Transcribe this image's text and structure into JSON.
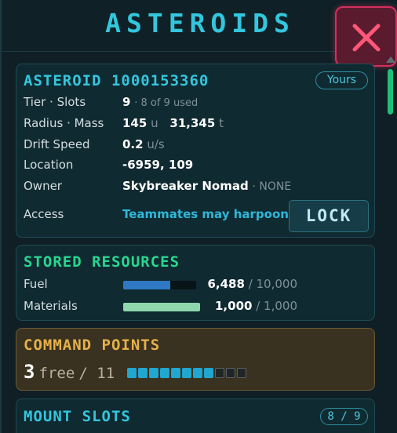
{
  "header": {
    "title": "ASTEROIDS"
  },
  "asteroid": {
    "name": "ASTEROID 1000153360",
    "ownership_badge": "Yours",
    "tier_slots": {
      "label": "Tier · Slots",
      "value": "9",
      "detail": "· 8 of 9 used"
    },
    "radius_mass": {
      "label": "Radius · Mass",
      "radius": "145",
      "radius_unit": "u",
      "mass": "31,345",
      "mass_unit": "t"
    },
    "drift_speed": {
      "label": "Drift Speed",
      "value": "0.2",
      "unit": "u/s"
    },
    "location": {
      "label": "Location",
      "value": "-6959, 109"
    },
    "owner": {
      "label": "Owner",
      "value": "Skybreaker Nomad",
      "detail": "· NONE"
    },
    "access": {
      "label": "Access",
      "value": "Teammates may harpoon",
      "button": "LOCK"
    }
  },
  "resources": {
    "title": "STORED RESOURCES",
    "items": [
      {
        "label": "Fuel",
        "amount": "6,488",
        "capacity": "/ 10,000",
        "fill_fraction": 0.6488,
        "color": "#2f78c4"
      },
      {
        "label": "Materials",
        "amount": "1,000",
        "capacity": "/ 1,000",
        "fill_fraction": 1.0,
        "color": "#8fd7ad"
      }
    ]
  },
  "command_points": {
    "title": "COMMAND POINTS",
    "free": "3",
    "free_label": "free",
    "total": "/ 11",
    "segments_total": 11,
    "segments_filled": 8
  },
  "mount_slots": {
    "title": "MOUNT SLOTS",
    "badge": "8 / 9"
  },
  "colors": {
    "accent": "#33c6dd",
    "resources": "#29d690",
    "command": "#e6b04a",
    "close": "#d2305d"
  },
  "icons": {
    "close": "close-icon",
    "scroll_up": "chevron-up-icon"
  }
}
